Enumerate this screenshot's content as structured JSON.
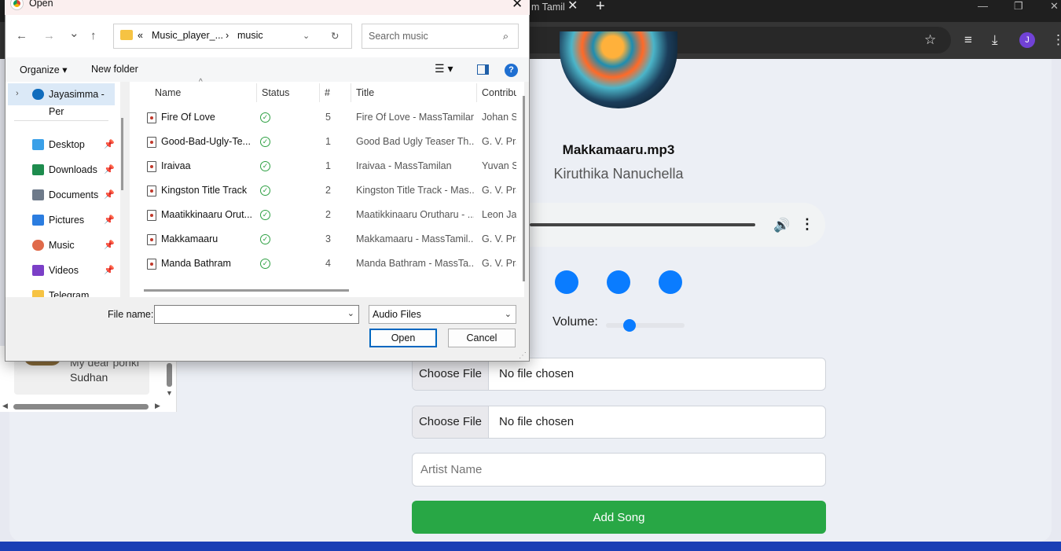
{
  "browser": {
    "tab_title_fragment": "m Tamil",
    "tab_close": "✕",
    "new_tab": "+",
    "window_controls": [
      "—",
      "❐",
      "✕"
    ],
    "toolbar_icons": [
      "star-icon",
      "playlist-icon",
      "download-icon",
      "more-icon"
    ],
    "avatar_initial": "J"
  },
  "player": {
    "song_title": "Makkamaaru.mp3",
    "artist": "Kiruthika Nanuchella",
    "volume_label": "Volume:",
    "volume_level": 0.3,
    "controls": [
      "previous",
      "play",
      "next"
    ],
    "accent_color": "#0a7cff"
  },
  "upload_form": {
    "file_inputs": [
      {
        "button": "Choose File",
        "status": "No file chosen"
      },
      {
        "button": "Choose File",
        "status": "No file chosen"
      }
    ],
    "artist_placeholder": "Artist Name",
    "add_button": "Add Song",
    "add_button_color": "#28a745"
  },
  "playlist": {
    "item_line1": "My dear ponki",
    "item_line2": "Sudhan"
  },
  "dialog": {
    "title": "Open",
    "close": "✕",
    "nav": {
      "back": "←",
      "forward": "→",
      "recent": "⌄",
      "up": "↑"
    },
    "address": {
      "prefix": "«",
      "crumb1": "Music_player_...",
      "sep": "›",
      "crumb2": "music"
    },
    "search_placeholder": "Search music",
    "commands": {
      "organize": "Organize ▾",
      "new_folder": "New folder",
      "help": "?"
    },
    "nav_items": [
      {
        "label": "Jayasimma - Per",
        "icon": "onedrive-icon",
        "color": "#0f6cbd"
      },
      {
        "label": "Desktop",
        "icon": "desktop-icon",
        "color": "#3aa0e8"
      },
      {
        "label": "Downloads",
        "icon": "downloads-icon",
        "color": "#1e8c4e"
      },
      {
        "label": "Documents",
        "icon": "documents-icon",
        "color": "#6e7a8a"
      },
      {
        "label": "Pictures",
        "icon": "pictures-icon",
        "color": "#2b7de0"
      },
      {
        "label": "Music",
        "icon": "music-icon",
        "color": "#e06a4a"
      },
      {
        "label": "Videos",
        "icon": "videos-icon",
        "color": "#7b3fc7"
      },
      {
        "label": "Telegram Deskto",
        "icon": "folder-icon",
        "color": "#f6c343"
      }
    ],
    "columns": [
      "Name",
      "Status",
      "#",
      "Title",
      "Contribu"
    ],
    "files": [
      {
        "name": "Fire Of Love",
        "num": "5",
        "title": "Fire Of Love - MassTamilan",
        "contrib": "Johan Sh"
      },
      {
        "name": "Good-Bad-Ugly-Te...",
        "num": "1",
        "title": "Good Bad Ugly Teaser Th...",
        "contrib": "G. V. Pra"
      },
      {
        "name": "Iraivaa",
        "num": "1",
        "title": "Iraivaa - MassTamilan",
        "contrib": "Yuvan Sl"
      },
      {
        "name": "Kingston Title Track",
        "num": "2",
        "title": "Kingston Title Track - Mas...",
        "contrib": "G. V. Pra"
      },
      {
        "name": "Maatikkinaaru Orut...",
        "num": "2",
        "title": "Maatikkinaaru Orutharu - ...",
        "contrib": "Leon Jan"
      },
      {
        "name": "Makkamaaru",
        "num": "3",
        "title": "Makkamaaru - MassTamil...",
        "contrib": "G. V. Pra"
      },
      {
        "name": "Manda Bathram",
        "num": "4",
        "title": "Manda Bathram - MassTa...",
        "contrib": "G. V. Pra"
      }
    ],
    "file_name_label": "File name:",
    "file_name_value": "",
    "file_type": "Audio Files",
    "open_button": "Open",
    "cancel_button": "Cancel"
  }
}
